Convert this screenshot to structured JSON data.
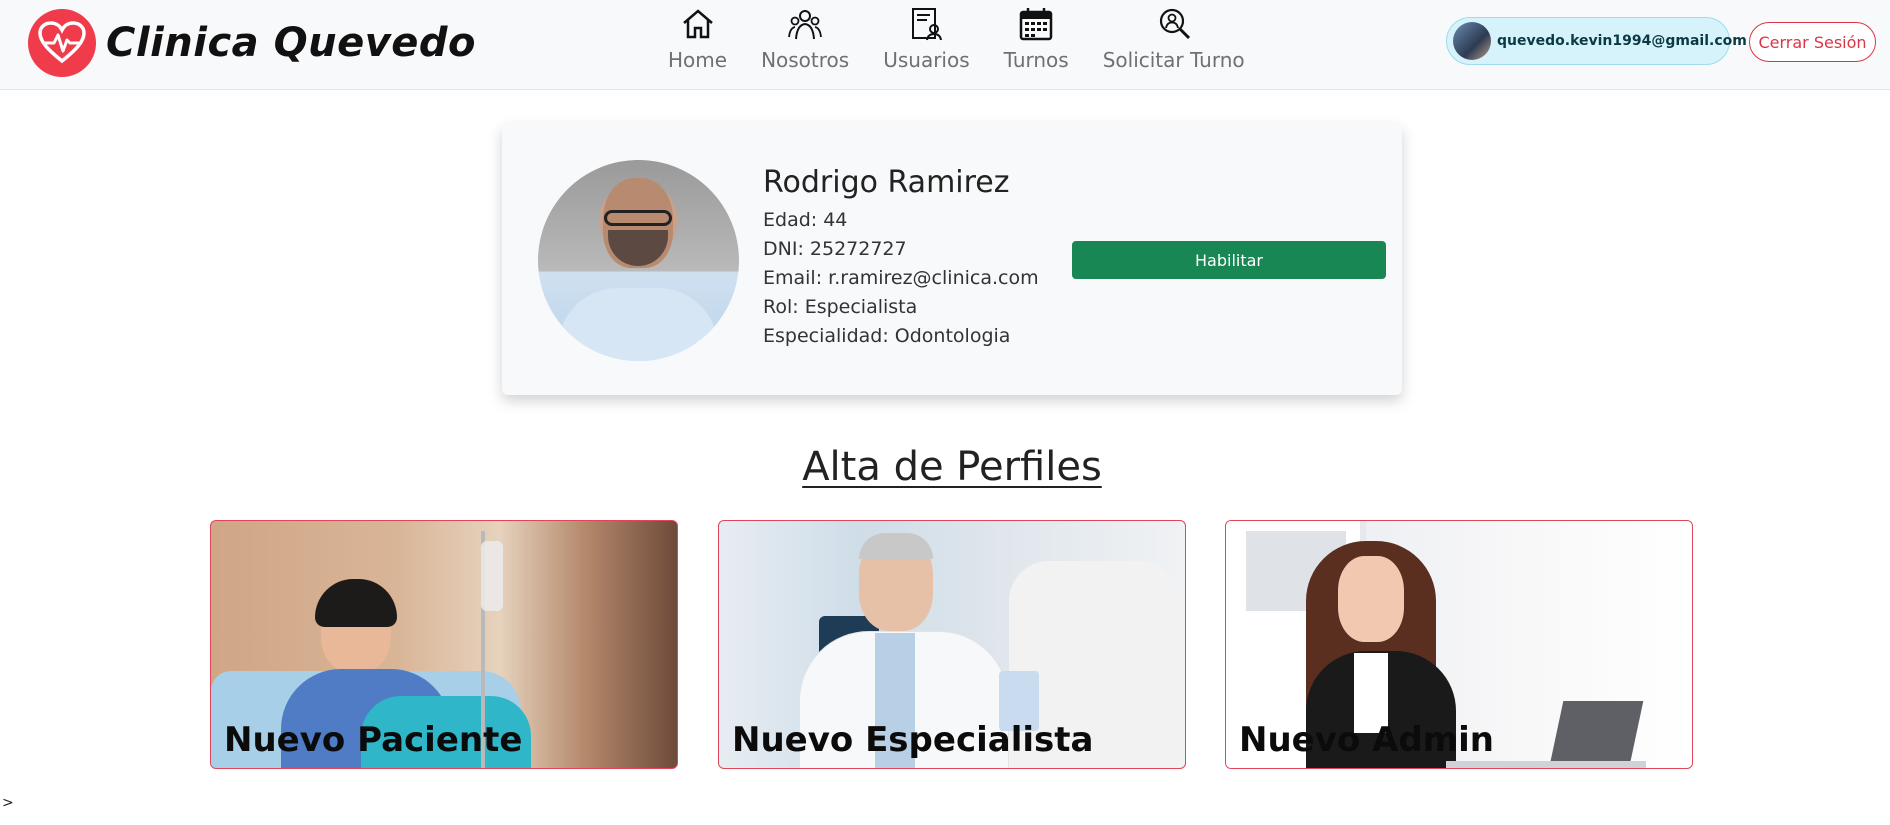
{
  "brand": {
    "name": "Clinica Quevedo",
    "logo_icon": "heart-pulse-icon",
    "logo_color": "#ef3b4a"
  },
  "nav": {
    "items": [
      {
        "label": "Home",
        "icon": "home-icon"
      },
      {
        "label": "Nosotros",
        "icon": "team-icon"
      },
      {
        "label": "Usuarios",
        "icon": "users-list-icon"
      },
      {
        "label": "Turnos",
        "icon": "calendar-icon"
      },
      {
        "label": "Solicitar Turno",
        "icon": "search-person-icon"
      }
    ]
  },
  "user": {
    "email": "quevedo.kevin1994@gmail.com"
  },
  "logout": {
    "label": "Cerrar Sesión"
  },
  "profile": {
    "name": "Rodrigo Ramirez",
    "edad": "Edad: 44",
    "dni": "DNI: 25272727",
    "email": "Email: r.ramirez@clinica.com",
    "rol": "Rol: Especialista",
    "especialidad": "Especialidad: Odontologia",
    "action_label": "Habilitar",
    "action_color": "#198754"
  },
  "section": {
    "title": "Alta de Perfiles"
  },
  "tiles": [
    {
      "label": "Nuevo Paciente"
    },
    {
      "label": "Nuevo Especialista"
    },
    {
      "label": "Nuevo Admin"
    }
  ],
  "footer_stray": ">",
  "colors": {
    "accent_danger": "#dc3545",
    "tile_border": "#e0465a",
    "navbar_bg": "#f8f9fa"
  }
}
